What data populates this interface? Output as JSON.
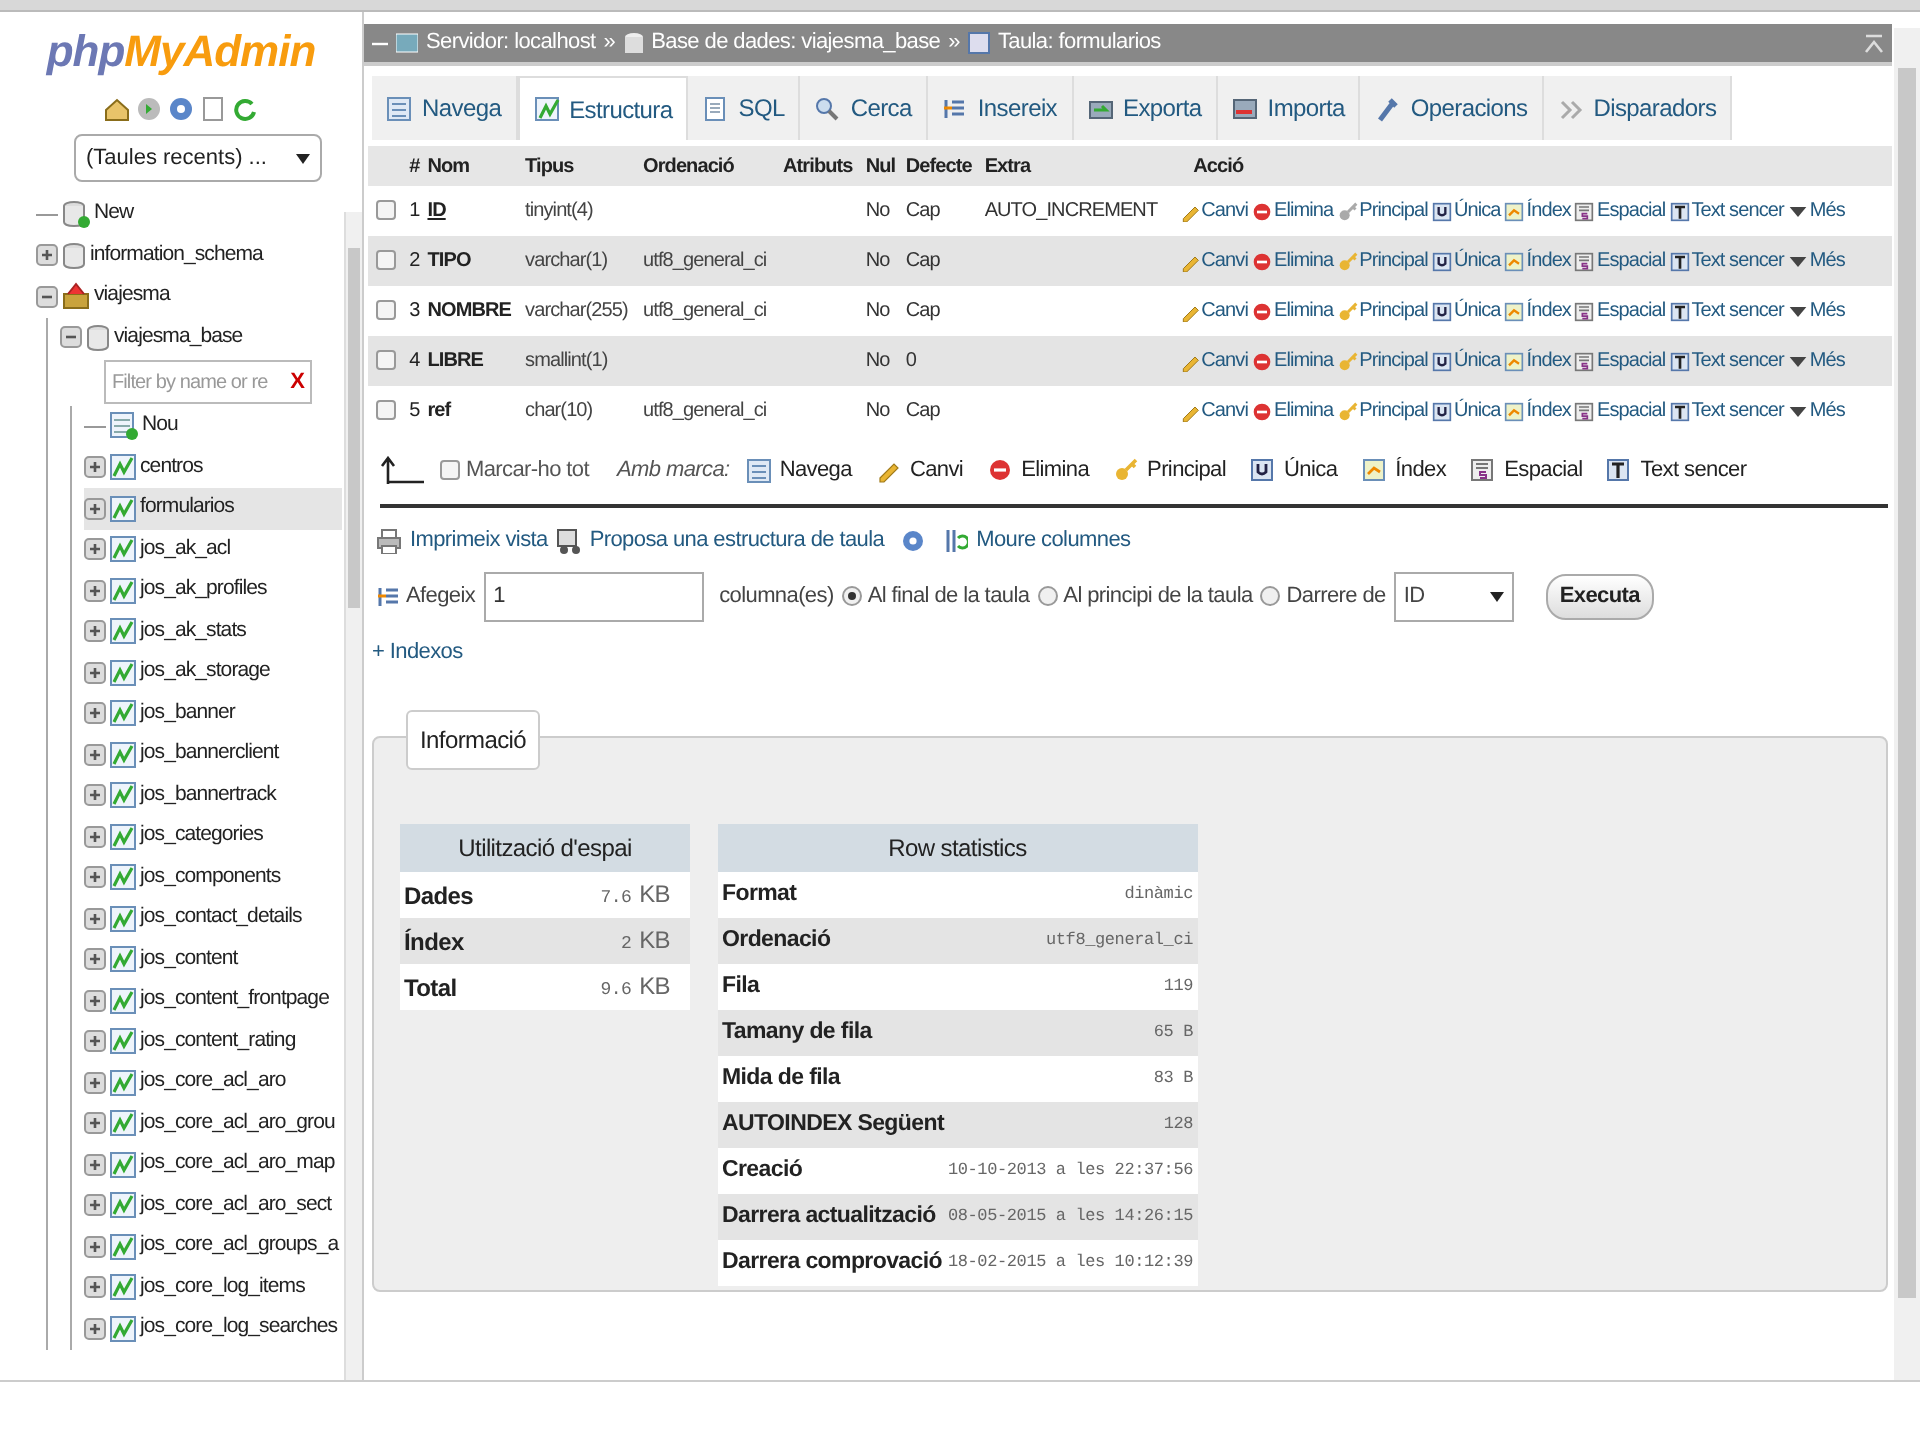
{
  "navigation": {
    "logo": {
      "left": "php",
      "right": "MyAdmin"
    },
    "recent_tables": "(Taules recents) ...",
    "tree": [
      {
        "kind": "new",
        "label": "New"
      },
      {
        "kind": "database",
        "label": "information_schema",
        "expanded": false
      },
      {
        "kind": "group",
        "label": "viajesma",
        "expanded": true,
        "children": [
          {
            "kind": "database",
            "label": "viajesma_base",
            "expanded": true,
            "filter": {
              "placeholder": "Filter by name or re",
              "clear": "X"
            },
            "children": [
              {
                "kind": "new",
                "label": "Nou"
              },
              {
                "kind": "table",
                "label": "centros",
                "selected": false
              },
              {
                "kind": "table",
                "label": "formularios",
                "selected": true
              },
              {
                "kind": "table",
                "label": "jos_ak_acl",
                "selected": false
              },
              {
                "kind": "table",
                "label": "jos_ak_profiles",
                "selected": false
              },
              {
                "kind": "table",
                "label": "jos_ak_stats",
                "selected": false
              },
              {
                "kind": "table",
                "label": "jos_ak_storage",
                "selected": false
              },
              {
                "kind": "table",
                "label": "jos_banner",
                "selected": false
              },
              {
                "kind": "table",
                "label": "jos_bannerclient",
                "selected": false
              },
              {
                "kind": "table",
                "label": "jos_bannertrack",
                "selected": false
              },
              {
                "kind": "table",
                "label": "jos_categories",
                "selected": false
              },
              {
                "kind": "table",
                "label": "jos_components",
                "selected": false
              },
              {
                "kind": "table",
                "label": "jos_contact_details",
                "selected": false
              },
              {
                "kind": "table",
                "label": "jos_content",
                "selected": false
              },
              {
                "kind": "table",
                "label": "jos_content_frontpage",
                "selected": false
              },
              {
                "kind": "table",
                "label": "jos_content_rating",
                "selected": false
              },
              {
                "kind": "table",
                "label": "jos_core_acl_aro",
                "selected": false
              },
              {
                "kind": "table",
                "label": "jos_core_acl_aro_grou",
                "selected": false
              },
              {
                "kind": "table",
                "label": "jos_core_acl_aro_map",
                "selected": false
              },
              {
                "kind": "table",
                "label": "jos_core_acl_aro_sect",
                "selected": false
              },
              {
                "kind": "table",
                "label": "jos_core_acl_groups_a",
                "selected": false
              },
              {
                "kind": "table",
                "label": "jos_core_log_items",
                "selected": false
              },
              {
                "kind": "table",
                "label": "jos_core_log_searches",
                "selected": false
              }
            ]
          }
        ]
      }
    ]
  },
  "breadcrumb": [
    {
      "kind": "server",
      "text": "Servidor: localhost",
      "separator": "»"
    },
    {
      "kind": "database",
      "text": "Base de dades: viajesma_base",
      "separator": "»"
    },
    {
      "kind": "table",
      "text": "Taula: formularios"
    }
  ],
  "tabs": [
    {
      "label": "Navega",
      "selected": false
    },
    {
      "label": "Estructura",
      "selected": true
    },
    {
      "label": "SQL",
      "selected": false
    },
    {
      "label": "Cerca",
      "selected": false
    },
    {
      "label": "Insereix",
      "selected": false
    },
    {
      "label": "Exporta",
      "selected": false
    },
    {
      "label": "Importa",
      "selected": false
    },
    {
      "label": "Operacions",
      "selected": false
    },
    {
      "label": "Disparadors",
      "selected": false
    }
  ],
  "table": {
    "columns": [
      "#",
      "Nom",
      "Tipus",
      "Ordenació",
      "Atributs",
      "Nul",
      "Defecte",
      "Extra",
      "Acció"
    ],
    "rows": [
      {
        "checked": false,
        "number": "1",
        "name": "ID",
        "primary": true,
        "type": "tinyint(4)",
        "null": "No",
        "default": "Cap",
        "extra": "AUTO_INCREMENT",
        "actions": [
          "Canvi",
          "Elimina",
          "Principal",
          "Única",
          "Índex",
          "Espacial",
          "Text sencer",
          "Més"
        ]
      },
      {
        "checked": false,
        "number": "2",
        "name": "TIPO",
        "primary": false,
        "type": "varchar(1)",
        "collation": "utf8_general_ci",
        "null": "No",
        "default": "Cap",
        "actions": [
          "Canvi",
          "Elimina",
          "Principal",
          "Única",
          "Índex",
          "Espacial",
          "Text sencer",
          "Més"
        ]
      },
      {
        "checked": false,
        "number": "3",
        "name": "NOMBRE",
        "primary": false,
        "type": "varchar(255)",
        "collation": "utf8_general_ci",
        "null": "No",
        "default": "Cap",
        "actions": [
          "Canvi",
          "Elimina",
          "Principal",
          "Única",
          "Índex",
          "Espacial",
          "Text sencer",
          "Més"
        ]
      },
      {
        "checked": false,
        "number": "4",
        "name": "LIBRE",
        "primary": false,
        "type": "smallint(1)",
        "null": "No",
        "default": "0",
        "actions": [
          "Canvi",
          "Elimina",
          "Principal",
          "Única",
          "Índex",
          "Espacial",
          "Text sencer",
          "Més"
        ]
      },
      {
        "checked": false,
        "number": "5",
        "name": "ref",
        "primary": false,
        "type": "char(10)",
        "collation": "utf8_general_ci",
        "null": "No",
        "default": "Cap",
        "actions": [
          "Canvi",
          "Elimina",
          "Principal",
          "Única",
          "Índex",
          "Espacial",
          "Text sencer",
          "Més"
        ]
      }
    ]
  },
  "bulk": {
    "check_all": {
      "label": "Marcar-ho tot",
      "checked": false
    },
    "with_selected": "Amb marca:",
    "actions": [
      "Navega",
      "Canvi",
      "Elimina",
      "Principal",
      "Única",
      "Índex",
      "Espacial",
      "Text sencer"
    ]
  },
  "links": [
    "Imprimeix vista",
    "Proposa una estructura de taula",
    "Moure columnes"
  ],
  "add_columns": {
    "label": "Afegeix",
    "count": "1",
    "suffix": "columna(es)",
    "positions": [
      {
        "label": "Al final de la taula",
        "selected": true
      },
      {
        "label": "Al principi de la taula",
        "selected": false
      },
      {
        "label": "Darrere de",
        "selected": false
      }
    ],
    "after_column": "ID",
    "button": "Executa"
  },
  "indexes_link": "+ Indexos",
  "information": {
    "legend": "Informació",
    "space": {
      "title": "Utilització d'espai",
      "rows": [
        {
          "label": "Dades",
          "value": "7.6",
          "unit": "KB"
        },
        {
          "label": "Índex",
          "value": "2",
          "unit": "KB"
        },
        {
          "label": "Total",
          "value": "9.6",
          "unit": "KB"
        }
      ]
    },
    "row_stats": {
      "title": "Row statistics",
      "rows": [
        {
          "label": "Format",
          "value": "dinàmic"
        },
        {
          "label": "Ordenació",
          "value": "utf8_general_ci"
        },
        {
          "label": "Fila",
          "value": "119"
        },
        {
          "label": "Tamany de fila",
          "value": "65 B"
        },
        {
          "label": "Mida de fila",
          "value": "83 B"
        },
        {
          "label": "AUTOINDEX Següent",
          "value": "128"
        },
        {
          "label": "Creació",
          "value": "10-10-2013 a les 22:37:56"
        },
        {
          "label": "Darrera actualització",
          "value": "08-05-2015 a les 14:26:15"
        },
        {
          "label": "Darrera comprovació",
          "value": "18-02-2015 a les 10:12:39"
        }
      ]
    }
  }
}
